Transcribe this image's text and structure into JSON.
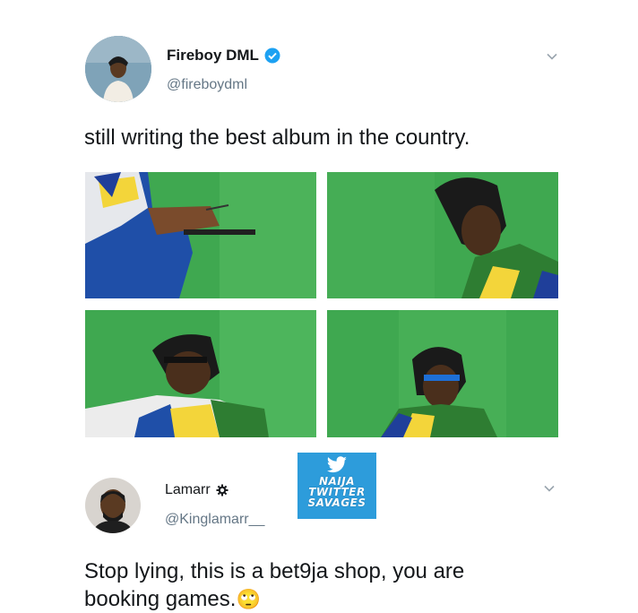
{
  "tweet1": {
    "display_name": "Fireboy DML",
    "handle": "@fireboydml",
    "verified": true,
    "text": "still writing the best album in the country.",
    "photos": [
      "photo-writing-on-tablet",
      "photo-looking-down",
      "photo-glasses-turned",
      "photo-glasses-front"
    ]
  },
  "tweet2": {
    "display_name": "Lamarr",
    "handle": "@Kinglamarr__",
    "text_line1": "Stop lying, this is a bet9ja shop, you are",
    "text_line2": "booking games.",
    "emoji": "🙄"
  },
  "watermark": {
    "line1": "NAIJA",
    "line2": "TWITTER",
    "line3": "SAVAGES"
  },
  "colors": {
    "verified_blue": "#1da1f2",
    "photo_green": "#3aa34c",
    "handle_grey": "#657786",
    "watermark_blue": "#2d9cdb"
  }
}
